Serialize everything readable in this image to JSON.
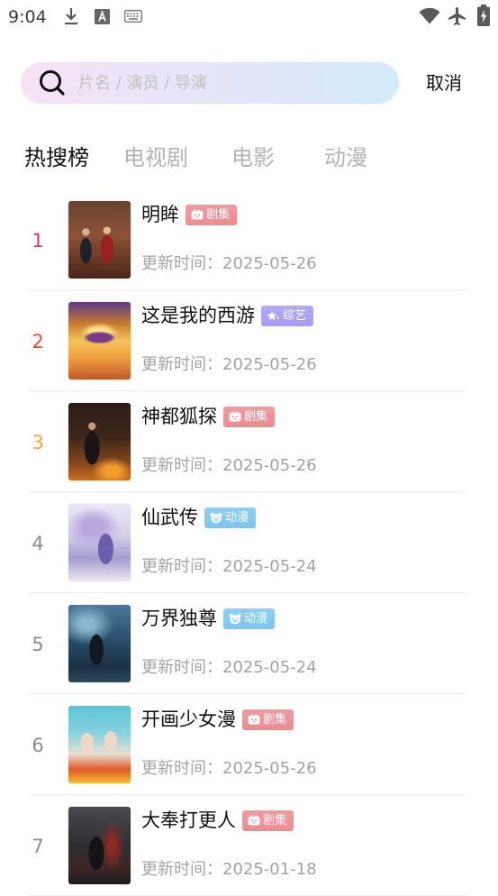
{
  "status_bar": {
    "time": "9:04",
    "left_icons": [
      "download-icon",
      "a-letter-icon",
      "keyboard-icon"
    ],
    "right_icons": [
      "wifi-icon",
      "airplane-icon",
      "battery-charging-icon"
    ]
  },
  "search": {
    "icon": "search-icon",
    "placeholder": "片名 / 演员 / 导演",
    "cancel_label": "取消"
  },
  "tabs": [
    {
      "label": "热搜榜",
      "selected": true
    },
    {
      "label": "电视剧",
      "selected": false
    },
    {
      "label": "电影",
      "selected": false
    },
    {
      "label": "动漫",
      "selected": false
    }
  ],
  "ranking": [
    {
      "rank": "1",
      "title": "明眸",
      "badge": "剧集",
      "badge_icon": "tv-icon",
      "update_time": "更新时间：2025-05-26"
    },
    {
      "rank": "2",
      "title": "这是我的西游",
      "badge": "综艺",
      "badge_icon": "star-icon",
      "update_time": "更新时间：2025-05-26"
    },
    {
      "rank": "3",
      "title": "神都狐探",
      "badge": "剧集",
      "badge_icon": "tv-icon",
      "update_time": "更新时间：2025-05-26"
    },
    {
      "rank": "4",
      "title": "仙武传",
      "badge": "动漫",
      "badge_icon": "bear-icon",
      "update_time": "更新时间：2025-05-24"
    },
    {
      "rank": "5",
      "title": "万界独尊",
      "badge": "动漫",
      "badge_icon": "bear-icon",
      "update_time": "更新时间：2025-05-24"
    },
    {
      "rank": "6",
      "title": "开画少女漫",
      "badge": "剧集",
      "badge_icon": "tv-icon",
      "update_time": "更新时间：2025-05-26"
    },
    {
      "rank": "7",
      "title": "大奉打更人",
      "badge": "剧集",
      "badge_icon": "tv-icon",
      "update_time": "更新时间：2025-01-18"
    }
  ],
  "colors": {
    "rank_top": [
      "#e5336c",
      "#ee4e3f",
      "#f5a640"
    ],
    "rank_default": "#8c8c8c",
    "badge": {
      "剧集": "#ee8b92",
      "综艺": "#a69cf6",
      "动漫": "#7ac7f2"
    },
    "text_primary": "#111111",
    "text_secondary": "#a3a3a3",
    "tab_inactive": "#b3b3b3",
    "search_gradient": [
      "#f7e2f5",
      "#d3ebf9"
    ]
  }
}
